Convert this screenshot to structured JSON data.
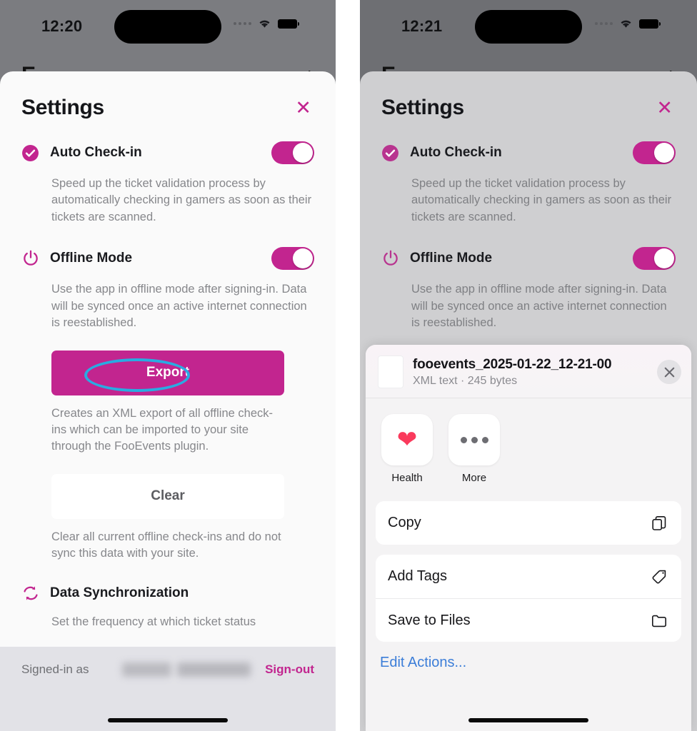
{
  "theme": {
    "accent": "#c2258f",
    "annotation": "#29abe2",
    "link_blue": "#3b7dd8",
    "sheet_bg_left": "#fafafa",
    "sheet_bg_right": "#cfcfd1",
    "phone_bg": "#7b7c80",
    "heart_red": "#fa3a5c"
  },
  "left_phone": {
    "status": {
      "time": "12:20",
      "signal_icon": "signal-dots-icon",
      "wifi_icon": "wifi-icon",
      "battery_icon": "battery-icon"
    },
    "background_app": {
      "title": "E",
      "add_icon": "plus-icon"
    },
    "settings": {
      "title": "Settings",
      "close_icon": "close-icon",
      "auto_checkin": {
        "icon": "check-circle-icon",
        "label": "Auto Check-in",
        "toggle_state": "on",
        "description": "Speed up the ticket validation process by automatically checking in gamers as soon as their tickets are scanned."
      },
      "offline_mode": {
        "icon": "power-icon",
        "label": "Offline Mode",
        "toggle_state": "on",
        "description": "Use the app in offline mode after signing-in. Data will be synced once an active internet connection is reestablished."
      },
      "export_button": "Export",
      "export_caption": "Creates an XML export of all offline check-ins which can be imported to your site through the FooEvents plugin.",
      "clear_button": "Clear",
      "clear_caption": "Clear all current offline check-ins and do not sync this data with your site.",
      "data_sync": {
        "icon": "sync-icon",
        "label": "Data Synchronization",
        "description": "Set the frequency at which ticket status"
      }
    },
    "footer": {
      "signed_in_label": "Signed-in as",
      "signed_in_name": "",
      "signout_label": "Sign-out"
    }
  },
  "right_phone": {
    "status": {
      "time": "12:21",
      "signal_icon": "signal-dots-icon",
      "wifi_icon": "wifi-icon",
      "battery_icon": "battery-icon"
    },
    "background_app": {
      "title": "E",
      "add_icon": "plus-icon"
    },
    "settings": {
      "title": "Settings",
      "close_icon": "close-icon",
      "auto_checkin": {
        "icon": "check-circle-icon",
        "label": "Auto Check-in",
        "toggle_state": "on",
        "description": "Speed up the ticket validation process by automatically checking in gamers as soon as their tickets are scanned."
      },
      "offline_mode": {
        "icon": "power-icon",
        "label": "Offline Mode",
        "toggle_state": "on",
        "description": "Use the app in offline mode after signing-in. Data will be synced once an active internet connection is reestablished."
      }
    },
    "share_sheet": {
      "file_icon": "document-icon",
      "file_name": "fooevents_2025-01-22_12-21-00",
      "file_subtitle": "XML text · 245 bytes",
      "close_icon": "close-circle-icon",
      "apps": [
        {
          "name": "Health",
          "icon": "heart-icon"
        },
        {
          "name": "More",
          "icon": "ellipsis-icon"
        }
      ],
      "actions": [
        {
          "label": "Copy",
          "icon": "copy-icon"
        },
        {
          "label": "Add Tags",
          "icon": "tag-icon"
        },
        {
          "label": "Save to Files",
          "icon": "folder-icon"
        }
      ],
      "edit_actions_label": "Edit Actions..."
    }
  }
}
